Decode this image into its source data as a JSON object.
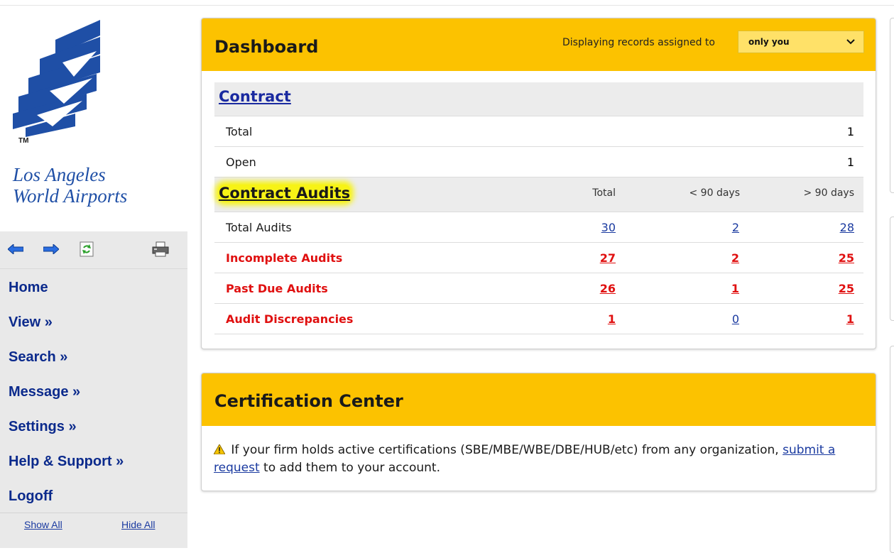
{
  "logo": {
    "tm": "TM",
    "line1": "Los Angeles",
    "line2": "World Airports"
  },
  "toolbar": [
    {
      "name": "back-arrow-icon"
    },
    {
      "name": "forward-arrow-icon"
    },
    {
      "name": "refresh-icon"
    },
    {
      "name": "print-icon"
    }
  ],
  "nav": [
    "Home",
    "View »",
    "Search »",
    "Message »",
    "Settings »",
    "Help & Support »",
    "Logoff"
  ],
  "show_all": "Show All",
  "hide_all": "Hide All",
  "dashboard": {
    "title": "Dashboard",
    "assign_label": "Displaying records assigned to",
    "assign_value": "only you",
    "contract": {
      "title": "Contract",
      "rows": [
        {
          "label": "Total",
          "value": "1"
        },
        {
          "label": "Open",
          "value": "1"
        }
      ]
    },
    "audits": {
      "title": "Contract Audits",
      "columns": [
        "Total",
        "< 90 days",
        "> 90 days"
      ],
      "rows": [
        {
          "label": "Total Audits",
          "values": [
            "30",
            "2",
            "28"
          ],
          "red": [
            false,
            false,
            false
          ]
        },
        {
          "label": "Incomplete Audits",
          "values": [
            "27",
            "2",
            "25"
          ],
          "red": [
            true,
            true,
            true
          ]
        },
        {
          "label": "Past Due Audits",
          "values": [
            "26",
            "1",
            "25"
          ],
          "red": [
            true,
            true,
            true
          ]
        },
        {
          "label": "Audit Discrepancies",
          "values": [
            "1",
            "0",
            "1"
          ],
          "red": [
            true,
            false,
            true
          ]
        }
      ]
    }
  },
  "cert": {
    "title": "Certification Center",
    "text_before": "If your firm holds active certifications (SBE/MBE/WBE/DBE/HUB/etc) from any organization,",
    "link": "submit a request",
    "text_after": "to add them to your account."
  },
  "colors": {
    "header_yellow": "#fcc200",
    "nav_blue": "#0b2a8c",
    "alert_red": "#e01010",
    "highlight": "#f7f316"
  }
}
